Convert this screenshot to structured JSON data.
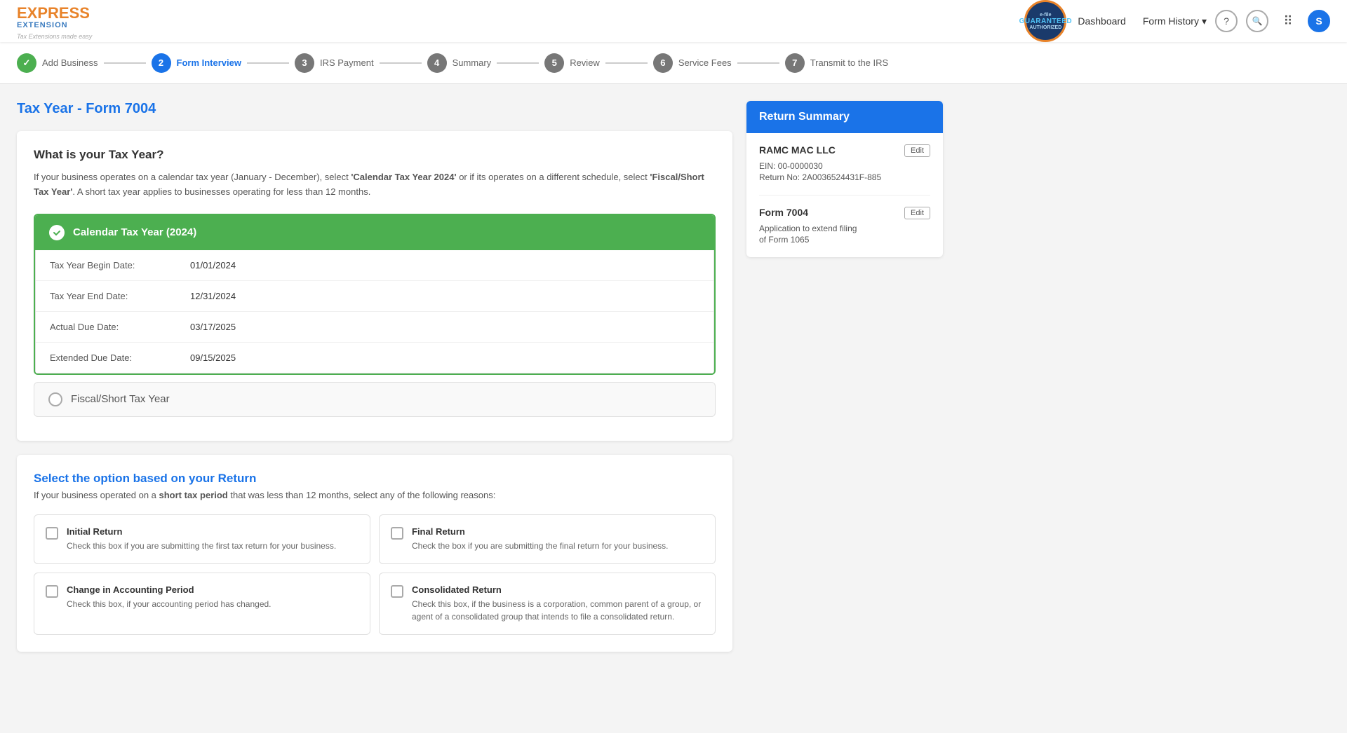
{
  "header": {
    "logo": {
      "express": "EXPRESS",
      "extension": "EXTENSION",
      "tagline": "Tax Extensions made easy"
    },
    "badge": {
      "top": "e-file",
      "middle": "GUARANTEED",
      "bottom": "AUTHORIZED"
    },
    "nav": {
      "dashboard": "Dashboard",
      "form_history": "Form History",
      "chevron": "▾"
    },
    "icons": {
      "help": "?",
      "search": "🔍",
      "grid": "⠿",
      "user_initial": "S"
    }
  },
  "stepper": {
    "steps": [
      {
        "num": "✓",
        "label": "Add Business",
        "state": "completed"
      },
      {
        "num": "2",
        "label": "Form Interview",
        "state": "active"
      },
      {
        "num": "3",
        "label": "IRS Payment",
        "state": "inactive"
      },
      {
        "num": "4",
        "label": "Summary",
        "state": "inactive"
      },
      {
        "num": "5",
        "label": "Review",
        "state": "inactive"
      },
      {
        "num": "6",
        "label": "Service Fees",
        "state": "inactive"
      },
      {
        "num": "7",
        "label": "Transmit to the IRS",
        "state": "inactive"
      }
    ]
  },
  "page": {
    "title": "Tax Year - Form 7004"
  },
  "tax_year_section": {
    "card_title": "What is your Tax Year?",
    "description_part1": "If your business operates on a calendar tax year (January - December), select ",
    "description_bold1": "'Calendar Tax Year 2024'",
    "description_part2": " or if its operates on a different schedule, select ",
    "description_bold2": "'Fiscal/Short Tax Year'",
    "description_part3": ". A short tax year applies to businesses operating for less than 12 months.",
    "calendar_option": {
      "label": "Calendar Tax Year (2024)",
      "selected": true,
      "dates": [
        {
          "label": "Tax Year Begin Date:",
          "value": "01/01/2024"
        },
        {
          "label": "Tax Year End Date:",
          "value": "12/31/2024"
        },
        {
          "label": "Actual Due Date:",
          "value": "03/17/2025"
        },
        {
          "label": "Extended Due Date:",
          "value": "09/15/2025"
        }
      ]
    },
    "fiscal_option": {
      "label": "Fiscal/Short Tax Year",
      "selected": false
    }
  },
  "return_type_section": {
    "card_title": "Select the option based on your Return",
    "description_part1": "If your business operated on a ",
    "description_bold": "short tax period",
    "description_part2": " that was less than 12 months, select any of the following reasons:",
    "options": [
      {
        "id": "initial_return",
        "title": "Initial Return",
        "desc": "Check this box if you are submitting the first tax return for your business.",
        "checked": false
      },
      {
        "id": "final_return",
        "title": "Final Return",
        "desc": "Check the box if you are submitting the final return for your business.",
        "checked": false
      },
      {
        "id": "change_accounting",
        "title": "Change in Accounting Period",
        "desc": "Check this box, if your accounting period has changed.",
        "checked": false
      },
      {
        "id": "consolidated_return",
        "title": "Consolidated Return",
        "desc": "Check this box, if the business is a corporation, common parent of a group, or agent of a consolidated group that intends to file a consolidated return.",
        "checked": false
      }
    ]
  },
  "return_summary": {
    "header": "Return Summary",
    "company": {
      "name": "RAMC MAC LLC",
      "ein": "EIN: 00-0000030",
      "return_no": "Return No: 2A0036524431F-885",
      "edit_label": "Edit"
    },
    "form": {
      "name": "Form 7004",
      "desc1": "Application to extend filing",
      "desc2": "of Form 1065",
      "edit_label": "Edit"
    }
  }
}
